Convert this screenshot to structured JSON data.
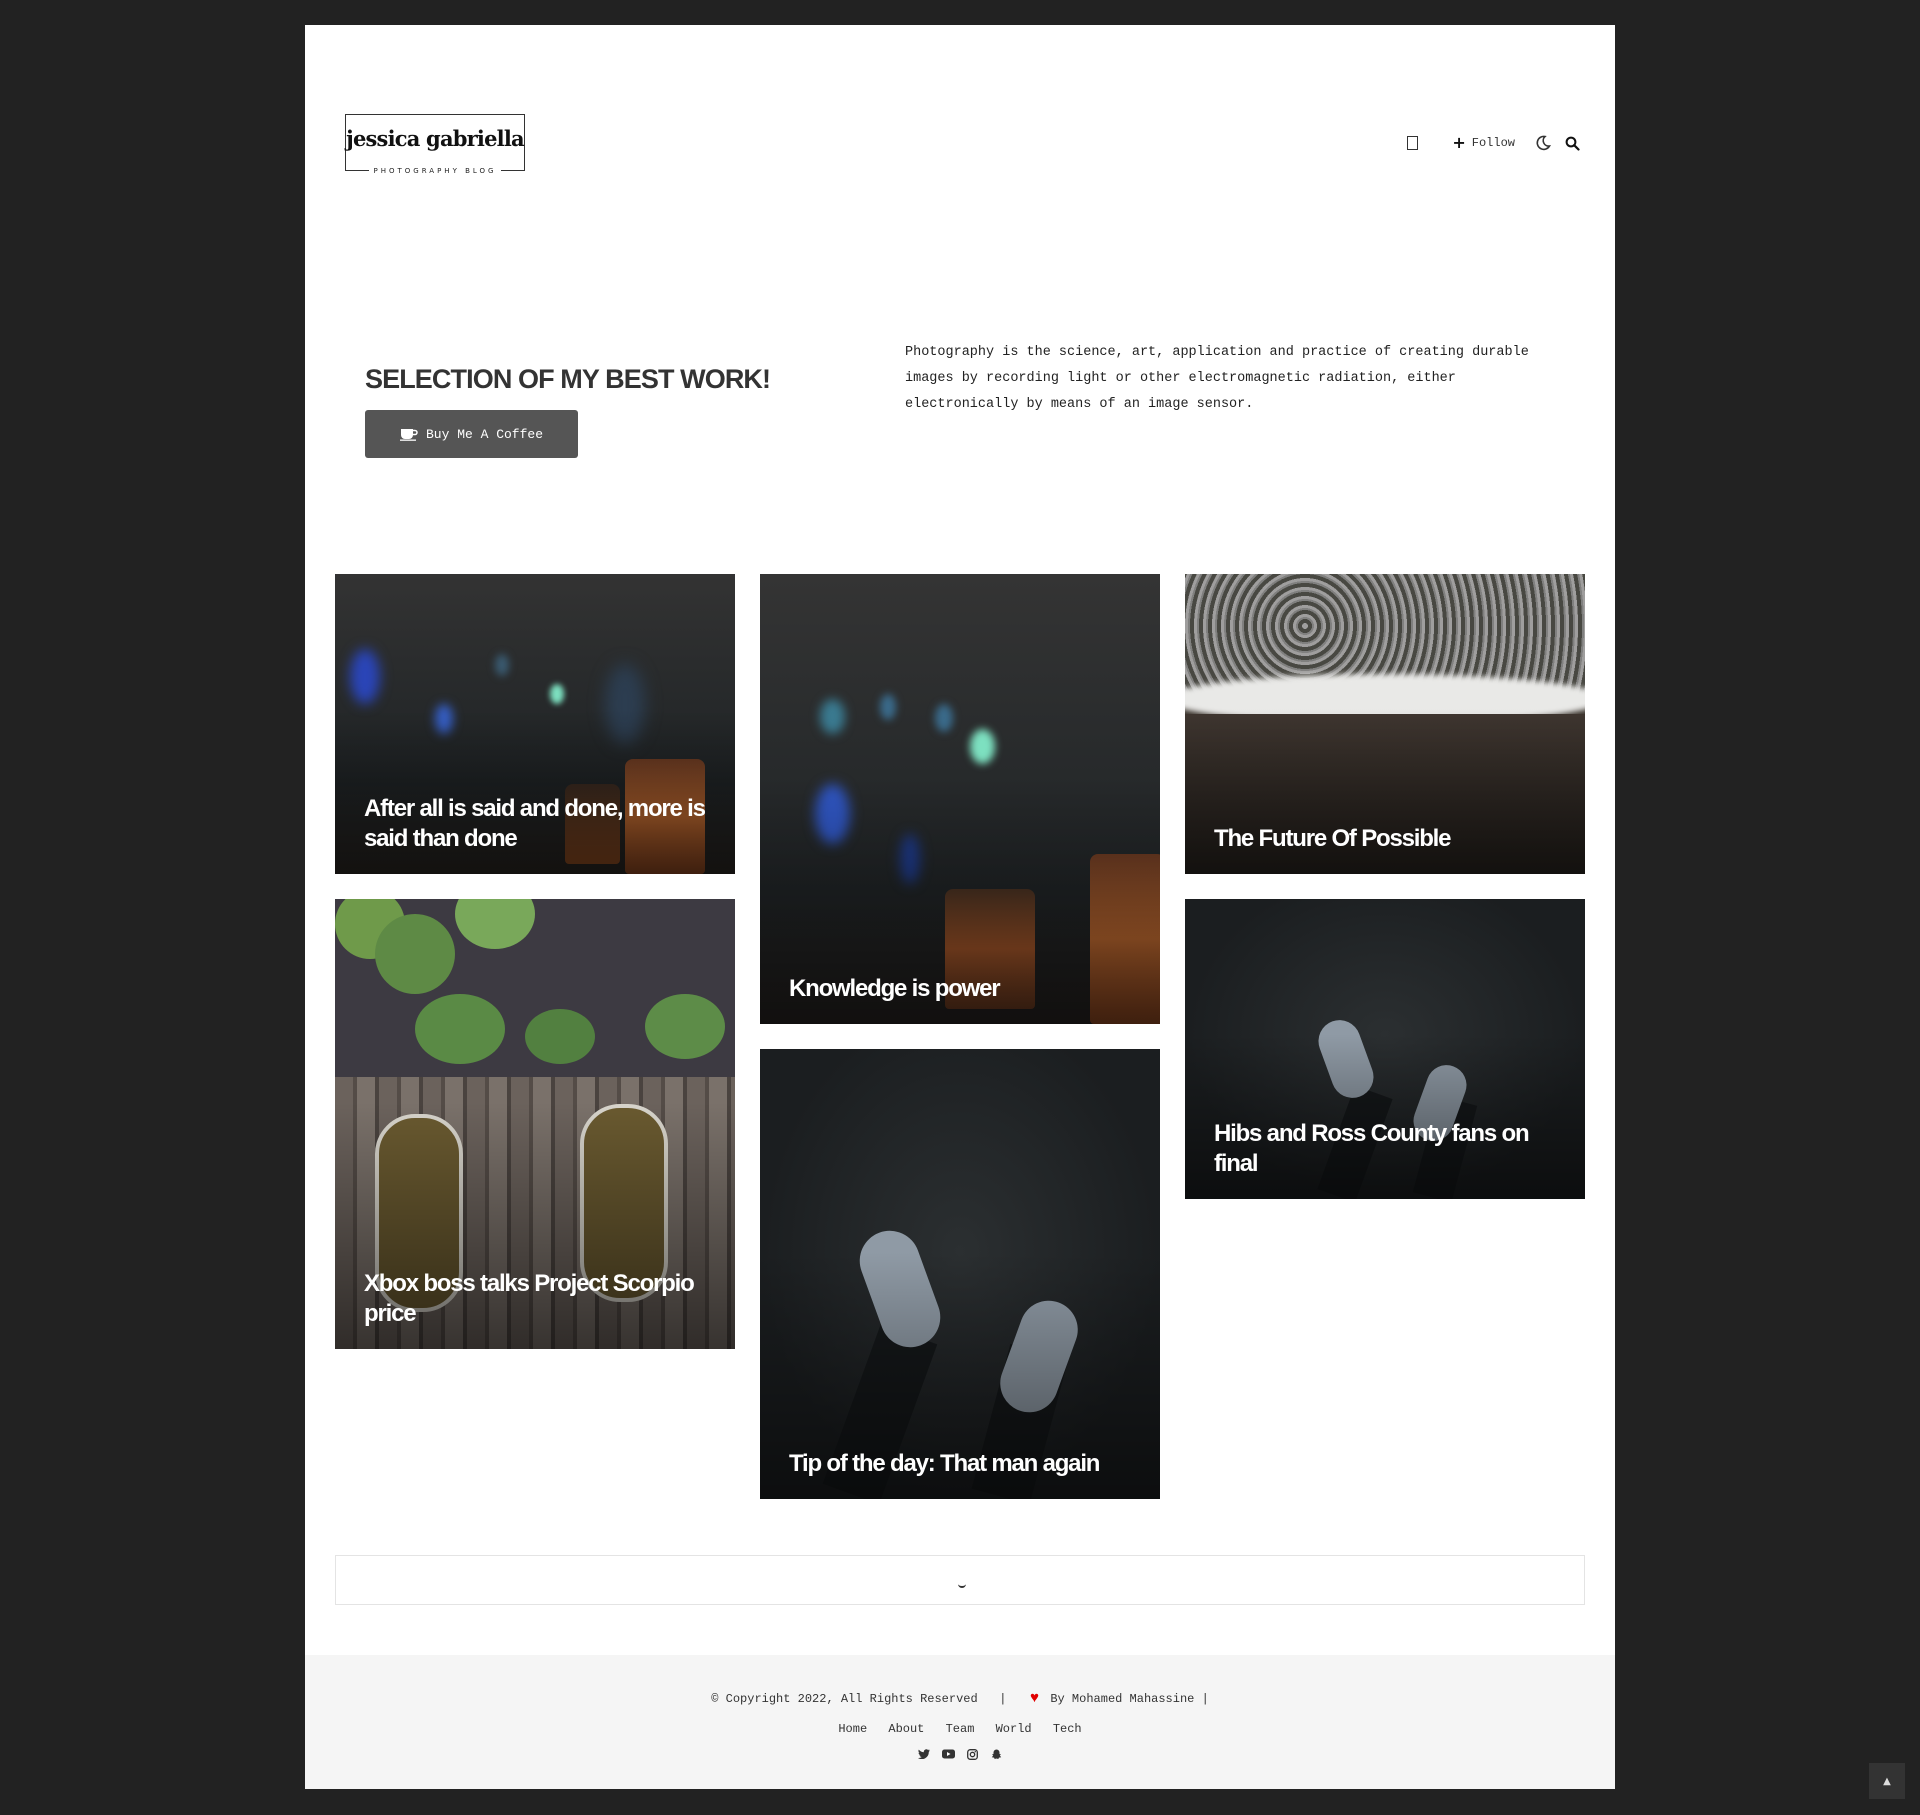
{
  "header": {
    "logo_name": "jessica gabriella",
    "logo_tagline": "PHOTOGRAPHY BLOG",
    "follow_label": "Follow",
    "icons": [
      "bookmark-icon",
      "plus-icon",
      "moon-icon",
      "search-icon"
    ]
  },
  "intro": {
    "headline": "SELECTION OF MY BEST WORK!",
    "button_label": "Buy Me A Coffee",
    "description": "Photography is the science, art, application and practice of creating durable images by recording light or other electromagnetic radiation, either electronically by means of an image sensor."
  },
  "posts": [
    {
      "title": "After all is said and done, more is said than done"
    },
    {
      "title": "Knowledge is power"
    },
    {
      "title": "The Future Of Possible"
    },
    {
      "title": "Xbox boss talks Project Scorpio price"
    },
    {
      "title": "Tip of the day: That man again"
    },
    {
      "title": "Hibs and Ross County fans on final"
    }
  ],
  "footer": {
    "copyright": "© Copyright 2022, All Rights Reserved",
    "separator": "|",
    "credit": "By Mohamed Mahassine",
    "links": [
      "Home",
      "About",
      "Team",
      "World",
      "Tech"
    ],
    "socials": [
      "twitter-icon",
      "youtube-icon",
      "instagram-icon",
      "snapchat-icon"
    ]
  },
  "colors": {
    "outer_background": "#222222",
    "page_background": "#ffffff",
    "button_background": "#555555",
    "footer_background": "#f5f5f5",
    "heart": "#e10000"
  }
}
